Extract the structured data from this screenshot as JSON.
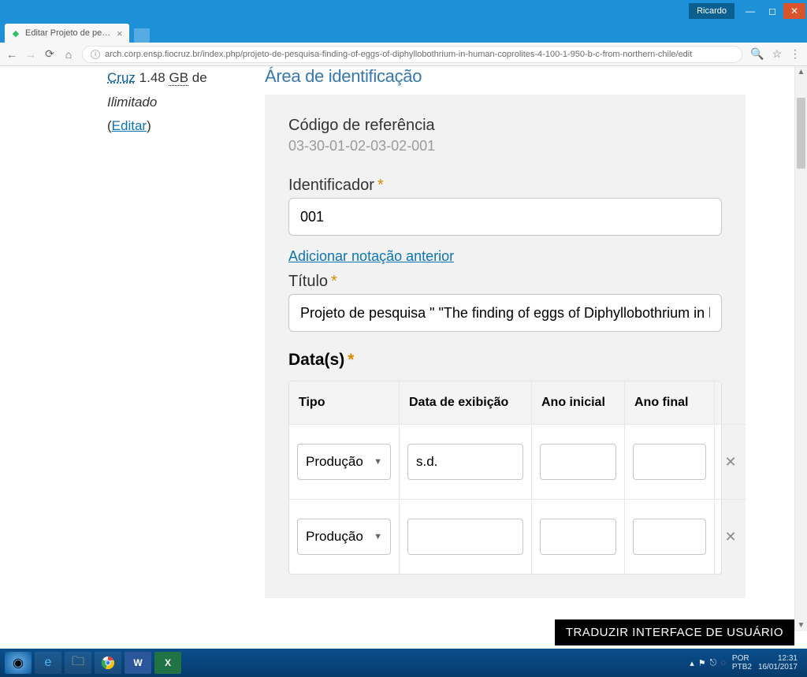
{
  "window": {
    "user": "Ricardo"
  },
  "tab": {
    "title": "Editar Projeto de pesqui"
  },
  "address": {
    "url": "arch.corp.ensp.fiocruz.br/index.php/projeto-de-pesquisa-finding-of-eggs-of-diphyllobothrium-in-human-coprolites-4-100-1-950-b-c-from-northern-chile/edit"
  },
  "sidebar": {
    "line1a": "Cruz",
    "line1b": "1.48",
    "line1c": "GB",
    "line1d": "de",
    "line1e": "Ilimitado",
    "open_paren": "(",
    "edit": "Editar",
    "close_paren": ")"
  },
  "main": {
    "section_title": "Área de identificação",
    "ref_label": "Código de referência",
    "ref_value": "03-30-01-02-03-02-001",
    "ident_label": "Identificador",
    "ident_value": "001",
    "alt_notation": "Adicionar notação anterior",
    "title_label": "Título",
    "title_value": "Projeto de pesquisa \" \"The finding of eggs of Diphyllobothrium in human coproli",
    "dates_label": "Data(s)",
    "dates_head": {
      "tipo": "Tipo",
      "display": "Data de exibição",
      "start": "Ano inicial",
      "end": "Ano final"
    },
    "rows": [
      {
        "tipo": "Produção",
        "display": "s.d.",
        "start": "",
        "end": ""
      },
      {
        "tipo": "Produção",
        "display": "",
        "start": "",
        "end": ""
      }
    ]
  },
  "translate_button": "TRADUZIR INTERFACE DE USUÁRIO",
  "taskbar": {
    "lang1": "POR",
    "lang2": "PTB2",
    "time": "12:31",
    "date": "16/01/2017"
  }
}
